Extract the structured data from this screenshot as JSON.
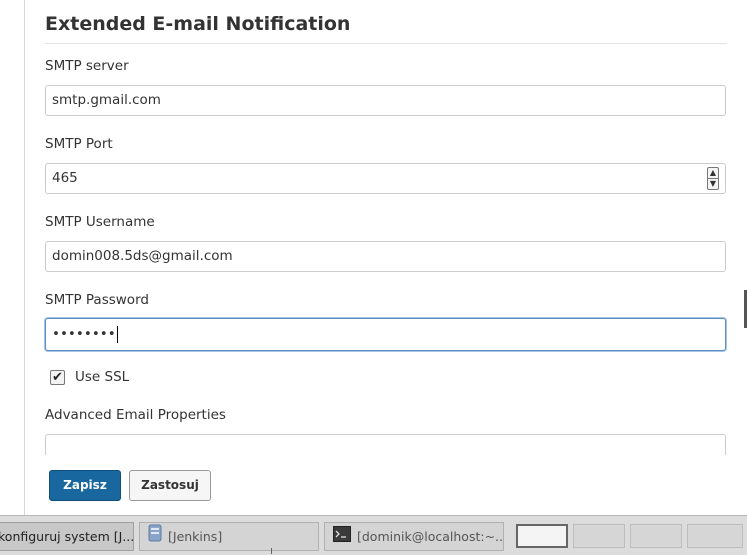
{
  "section": {
    "title": "Extended E-mail Notification"
  },
  "fields": {
    "smtp_server": {
      "label": "SMTP server",
      "value": "smtp.gmail.com"
    },
    "smtp_port": {
      "label": "SMTP Port",
      "value": "465"
    },
    "smtp_username": {
      "label": "SMTP Username",
      "value": "domin008.5ds@gmail.com"
    },
    "smtp_password": {
      "label": "SMTP Password",
      "value": "••••••••"
    },
    "use_ssl": {
      "label": "Use SSL",
      "checked": true,
      "mark": "✔"
    },
    "advanced": {
      "label": "Advanced Email Properties",
      "value": ""
    }
  },
  "buttons": {
    "save": "Zapisz",
    "apply": "Zastosuj"
  },
  "taskbar": {
    "tasks": [
      {
        "label": "konfiguruj system [J...",
        "icon": "browser-icon",
        "active": true
      },
      {
        "label": "[Jenkins]",
        "icon": "file-manager-icon",
        "active": false
      },
      {
        "label": "[dominik@localhost:~...",
        "icon": "terminal-icon",
        "active": false
      }
    ],
    "workspaces": 4
  },
  "colors": {
    "primary_button": "#19679f",
    "focus_border": "#5b8ec3"
  }
}
